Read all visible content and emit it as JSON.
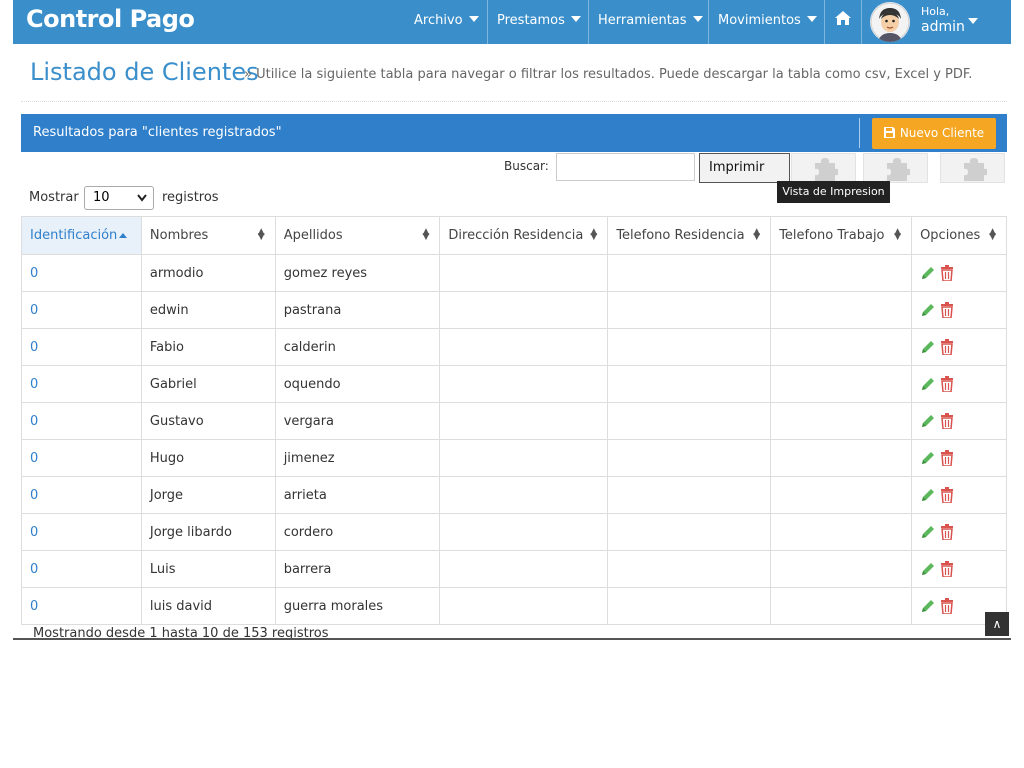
{
  "brand": "Control Pago",
  "nav": {
    "archivo": "Archivo",
    "prestamos": "Prestamos",
    "herramientas": "Herramientas",
    "movimientos": "Movimientos",
    "greeting": "Hola,",
    "user": "admin"
  },
  "page": {
    "title": "Listado de Clientes",
    "description": "» Utilice la siguiente tabla para navegar o filtrar los resultados. Puede descargar la tabla como csv, Excel y PDF."
  },
  "panel": {
    "title": "Resultados para \"clientes registrados\"",
    "new_button": "Nuevo Cliente"
  },
  "toolbar": {
    "search_label": "Buscar:",
    "search_value": "",
    "print_button": "Imprimir",
    "tooltip": "Vista de Impresion"
  },
  "length": {
    "label_before": "Mostrar",
    "selected": "10",
    "label_after": "registros"
  },
  "table": {
    "columns": [
      "Identificación",
      "Nombres",
      "Apellidos",
      "Dirección Residencia",
      "Telefono Residencia",
      "Telefono Trabajo",
      "Opciones"
    ],
    "rows": [
      {
        "id": "0",
        "nombres": "armodio",
        "apellidos": "gomez reyes",
        "direccion": "",
        "tel_res": "",
        "tel_trab": ""
      },
      {
        "id": "0",
        "nombres": "edwin",
        "apellidos": "pastrana",
        "direccion": "",
        "tel_res": "",
        "tel_trab": ""
      },
      {
        "id": "0",
        "nombres": "Fabio",
        "apellidos": "calderin",
        "direccion": "",
        "tel_res": "",
        "tel_trab": ""
      },
      {
        "id": "0",
        "nombres": "Gabriel",
        "apellidos": "oquendo",
        "direccion": "",
        "tel_res": "",
        "tel_trab": ""
      },
      {
        "id": "0",
        "nombres": "Gustavo",
        "apellidos": "vergara",
        "direccion": "",
        "tel_res": "",
        "tel_trab": ""
      },
      {
        "id": "0",
        "nombres": "Hugo",
        "apellidos": "jimenez",
        "direccion": "",
        "tel_res": "",
        "tel_trab": ""
      },
      {
        "id": "0",
        "nombres": "Jorge",
        "apellidos": "arrieta",
        "direccion": "",
        "tel_res": "",
        "tel_trab": ""
      },
      {
        "id": "0",
        "nombres": "Jorge libardo",
        "apellidos": "cordero",
        "direccion": "",
        "tel_res": "",
        "tel_trab": ""
      },
      {
        "id": "0",
        "nombres": "Luis",
        "apellidos": "barrera",
        "direccion": "",
        "tel_res": "",
        "tel_trab": ""
      },
      {
        "id": "0",
        "nombres": "luis david",
        "apellidos": "guerra morales",
        "direccion": "",
        "tel_res": "",
        "tel_trab": ""
      }
    ]
  },
  "info": "Mostrando desde 1 hasta 10 de 153 registros",
  "colors": {
    "navbar": "#3a8fcb",
    "panel": "#2f7fcb",
    "accent_button": "#f5a623",
    "edit_icon": "#5cb85c",
    "delete_icon": "#d9534f"
  },
  "icons": {
    "home": "home-icon",
    "edit": "pencil-icon",
    "delete": "trash-icon",
    "tool": "puzzle-icon",
    "save": "save-icon",
    "scroll_top": "double-chevron-up-icon"
  }
}
